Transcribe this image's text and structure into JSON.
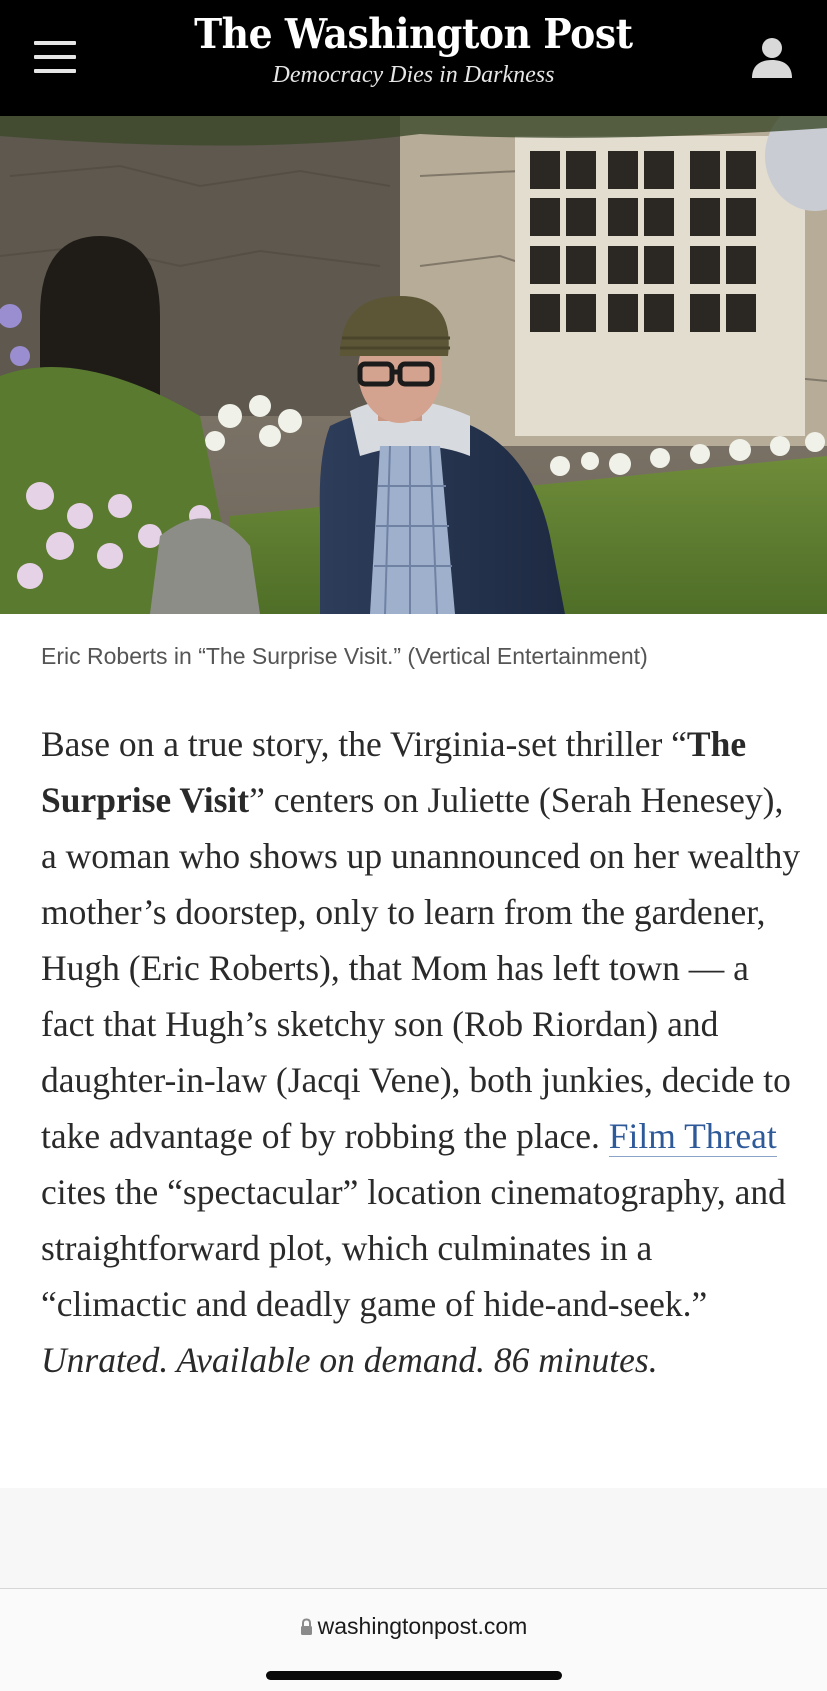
{
  "header": {
    "logo": "The Washington Post",
    "tagline": "Democracy Dies in Darkness",
    "menu_icon": "hamburger-menu-icon",
    "account_icon": "user-account-icon",
    "background": "#000000"
  },
  "photo": {
    "alt": "Man in knit beanie and glasses wearing a navy jacket standing in a garden in front of a stone house"
  },
  "caption": "Eric Roberts in “The Surprise Visit.” (Vertical Entertainment)",
  "article": {
    "intro": "Base on a true story, the Virginia-set thriller “",
    "title_bold": "The Surprise Visit",
    "body_1": "” centers on Juliette (Serah Henesey), a woman who shows up unannounced on her wealthy mother’s doorstep, only to learn from the gardener, Hugh (Eric Roberts), that Mom has left town — a fact that Hugh’s sketchy son (Rob Riordan) and daughter-in-law (Jacqi Vene), both junkies, decide to take advantage of by robbing the place. ",
    "link_text": "Film Threat",
    "body_2": " cites the “spectacular” location cinematography, and straightforward plot, which culminates in a “climactic and deadly game of hide-and-seek.” ",
    "italic_tail": "Unrated. Available on demand. 86 minutes.",
    "link_color": "#2f5a9a"
  },
  "browser": {
    "url": "washingtonpost.com",
    "lock_icon": "lock-icon"
  }
}
